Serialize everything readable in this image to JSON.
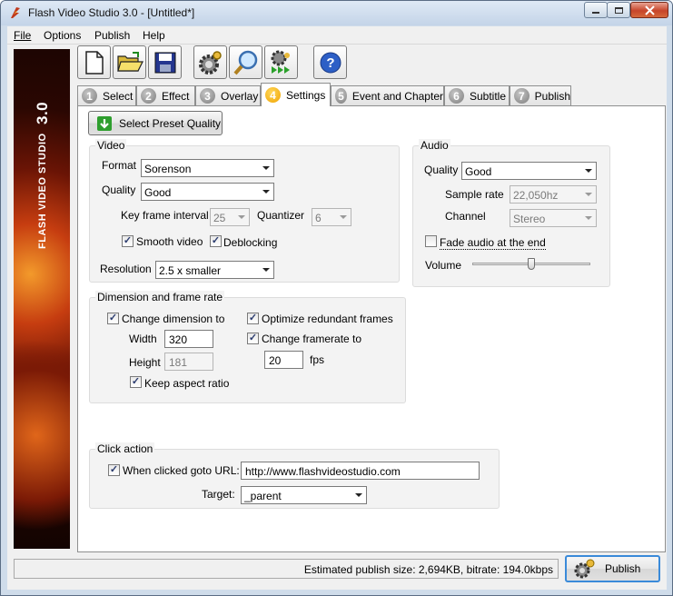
{
  "window": {
    "title": "Flash Video Studio 3.0 - [Untitled*]"
  },
  "menu": {
    "file": "File",
    "options": "Options",
    "publish": "Publish",
    "help": "Help"
  },
  "banner": {
    "text": "FLASH VIDEO STUDIO",
    "version": "3.0"
  },
  "toolbar": [
    "new-file-icon",
    "open-folder-icon",
    "save-disk-icon",
    "settings-gear-icon",
    "search-magnifier-icon",
    "batch-publish-icon",
    "help-icon"
  ],
  "tabs": [
    {
      "num": "1",
      "label": "Select"
    },
    {
      "num": "2",
      "label": "Effect"
    },
    {
      "num": "3",
      "label": "Overlay"
    },
    {
      "num": "4",
      "label": "Settings"
    },
    {
      "num": "5",
      "label": "Event and Chapter"
    },
    {
      "num": "6",
      "label": "Subtitle"
    },
    {
      "num": "7",
      "label": "Publish"
    }
  ],
  "preset_button": "Select Preset Quality",
  "video": {
    "title": "Video",
    "format_label": "Format",
    "format_value": "Sorenson",
    "quality_label": "Quality",
    "quality_value": "Good",
    "keyframe_label": "Key frame interval",
    "keyframe_value": "25",
    "quantizer_label": "Quantizer",
    "quantizer_value": "6",
    "smooth_label": "Smooth video",
    "smooth_checked": true,
    "deblocking_label": "Deblocking",
    "deblocking_checked": true,
    "resolution_label": "Resolution",
    "resolution_value": "2.5 x smaller"
  },
  "audio": {
    "title": "Audio",
    "quality_label": "Quality",
    "quality_value": "Good",
    "samplerate_label": "Sample rate",
    "samplerate_value": "22,050hz",
    "channel_label": "Channel",
    "channel_value": "Stereo",
    "fade_label": "Fade audio at the end",
    "fade_checked": false,
    "volume_label": "Volume",
    "volume_level": 0.5
  },
  "dimension": {
    "title": "Dimension and frame rate",
    "change_dim_label": "Change dimension to",
    "change_dim_checked": true,
    "width_label": "Width",
    "width_value": "320",
    "height_label": "Height",
    "height_value": "181",
    "keep_aspect_label": "Keep aspect ratio",
    "keep_aspect_checked": true,
    "optimize_label": "Optimize redundant frames",
    "optimize_checked": true,
    "change_fr_label": "Change framerate to",
    "change_fr_checked": true,
    "fps_value": "20",
    "fps_label": "fps"
  },
  "click": {
    "title": "Click action",
    "goto_label": "When clicked goto URL:",
    "goto_checked": true,
    "url_value": "http://www.flashvideostudio.com",
    "target_label": "Target:",
    "target_value": "_parent"
  },
  "status": {
    "text": "Estimated publish size: 2,694KB, bitrate: 194.0kbps"
  },
  "publish_button": "Publish"
}
